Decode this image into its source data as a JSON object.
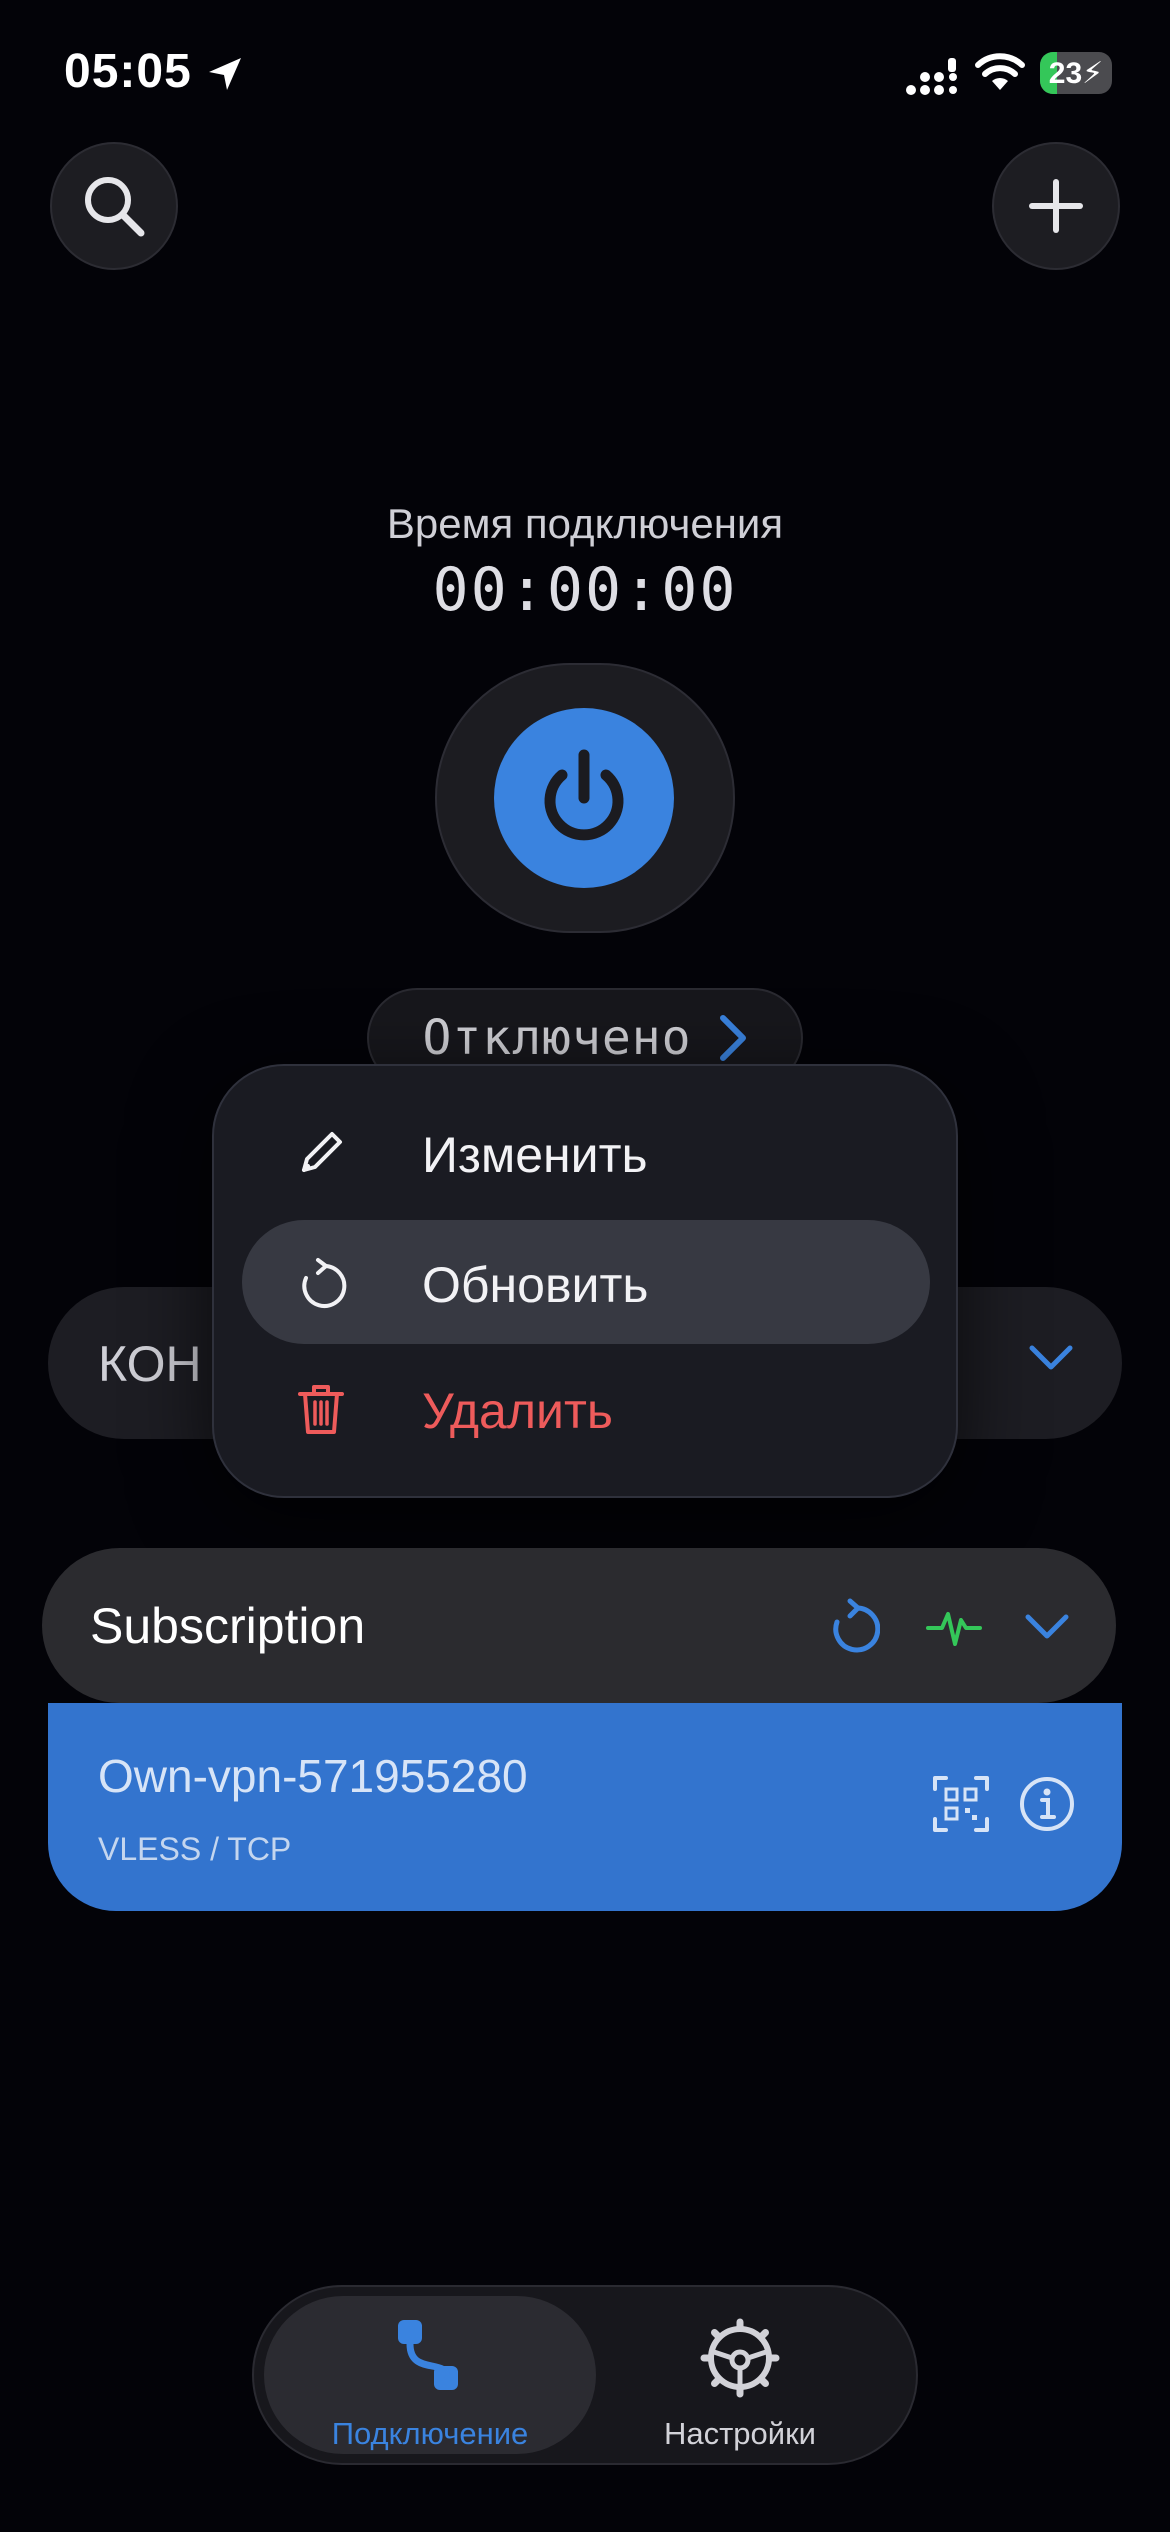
{
  "status_bar": {
    "time": "05:05",
    "battery": "23"
  },
  "connection": {
    "label": "Время подключения",
    "timer": "00:00:00",
    "status": "Отключено"
  },
  "config": {
    "label": "КОН"
  },
  "context_menu": {
    "items": [
      {
        "label": "Изменить",
        "icon": "pencil-icon"
      },
      {
        "label": "Обновить",
        "icon": "refresh-icon"
      },
      {
        "label": "Удалить",
        "icon": "trash-icon"
      }
    ]
  },
  "subscription": {
    "title": "Subscription",
    "server": {
      "name": "Own-vpn-571955280",
      "protocol": "VLESS / TCP"
    }
  },
  "tabs": [
    {
      "label": "Подключение",
      "active": true
    },
    {
      "label": "Настройки",
      "active": false
    }
  ],
  "colors": {
    "accent": "#3a83df",
    "danger": "#ee5b5b",
    "health": "#34c759",
    "background": "#030308"
  }
}
